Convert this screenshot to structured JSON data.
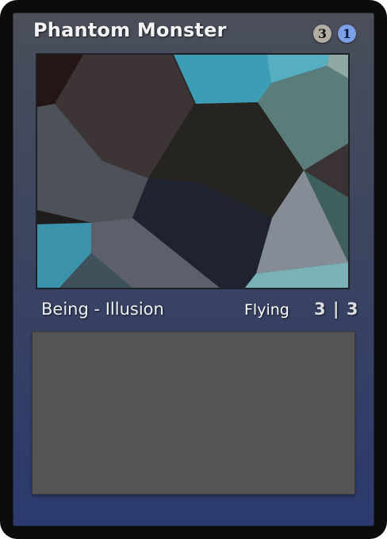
{
  "card": {
    "name": "Phantom Monster",
    "mana_cost": [
      {
        "symbol": "3",
        "kind": "generic",
        "color": "#b3ada2"
      },
      {
        "symbol": "1",
        "kind": "blue",
        "color": "#7ea0e8"
      }
    ],
    "type_line": "Being - Illusion",
    "keyword": "Flying",
    "power": "3",
    "toughness": "3",
    "power_toughness": "3 | 3",
    "rules_text": "",
    "frame_colors": {
      "border": "#0c0c0c",
      "frame_top": "#4a4f5a",
      "frame_bottom": "#2b3a6e",
      "textbox": "#555557"
    }
  }
}
